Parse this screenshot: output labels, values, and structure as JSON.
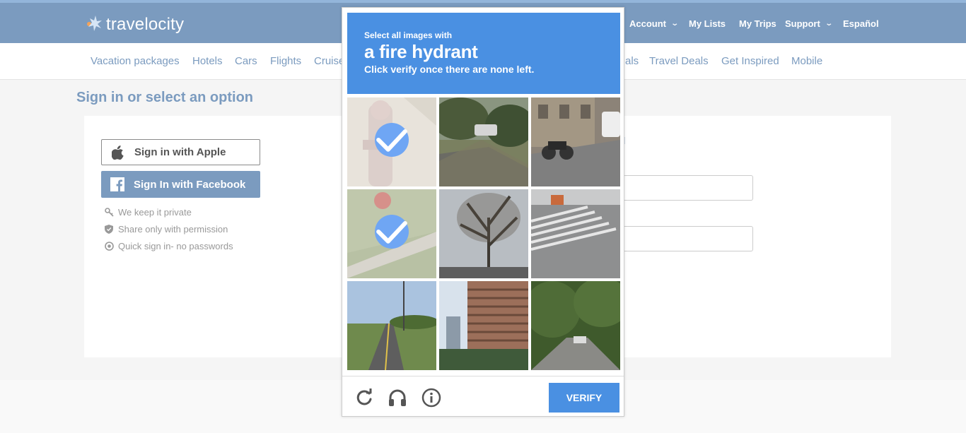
{
  "brand": {
    "name": "travelocity"
  },
  "topnav": {
    "account": "Account",
    "my_lists": "My Lists",
    "my_trips": "My Trips",
    "support": "Support",
    "language": "Español"
  },
  "subnav": [
    "Vacation packages",
    "Hotels",
    "Cars",
    "Flights",
    "Cruise",
    "als",
    "Travel Deals",
    "Get Inspired",
    "Mobile"
  ],
  "page": {
    "title": "Sign in or select an option",
    "apple_button": "Sign in with Apple",
    "facebook_button": "Sign In with Facebook",
    "perks": [
      "We keep it private",
      "Share only with permission",
      "Quick sign in- no passwords"
    ],
    "right_link_fragment": "il"
  },
  "captcha": {
    "line1": "Select all images with",
    "line2": "a fire hydrant",
    "line3": "Click verify once there are none left.",
    "verify_label": "VERIFY",
    "tiles": [
      {
        "name": "hydrant-closeup",
        "selected": true
      },
      {
        "name": "driveway-trees",
        "selected": false
      },
      {
        "name": "street-motorcycle",
        "selected": false
      },
      {
        "name": "hydrant-grass",
        "selected": true
      },
      {
        "name": "bare-tree-road",
        "selected": false
      },
      {
        "name": "crosswalk",
        "selected": false
      },
      {
        "name": "road-power-lines",
        "selected": false
      },
      {
        "name": "tall-building",
        "selected": false
      },
      {
        "name": "forest-road",
        "selected": false
      }
    ],
    "icons": [
      "reload-icon",
      "headphones-icon",
      "info-icon"
    ]
  },
  "colors": {
    "brand_blue": "#7b9bbf",
    "captcha_blue": "#4a90e2",
    "check_blue": "#6fa6f4"
  }
}
